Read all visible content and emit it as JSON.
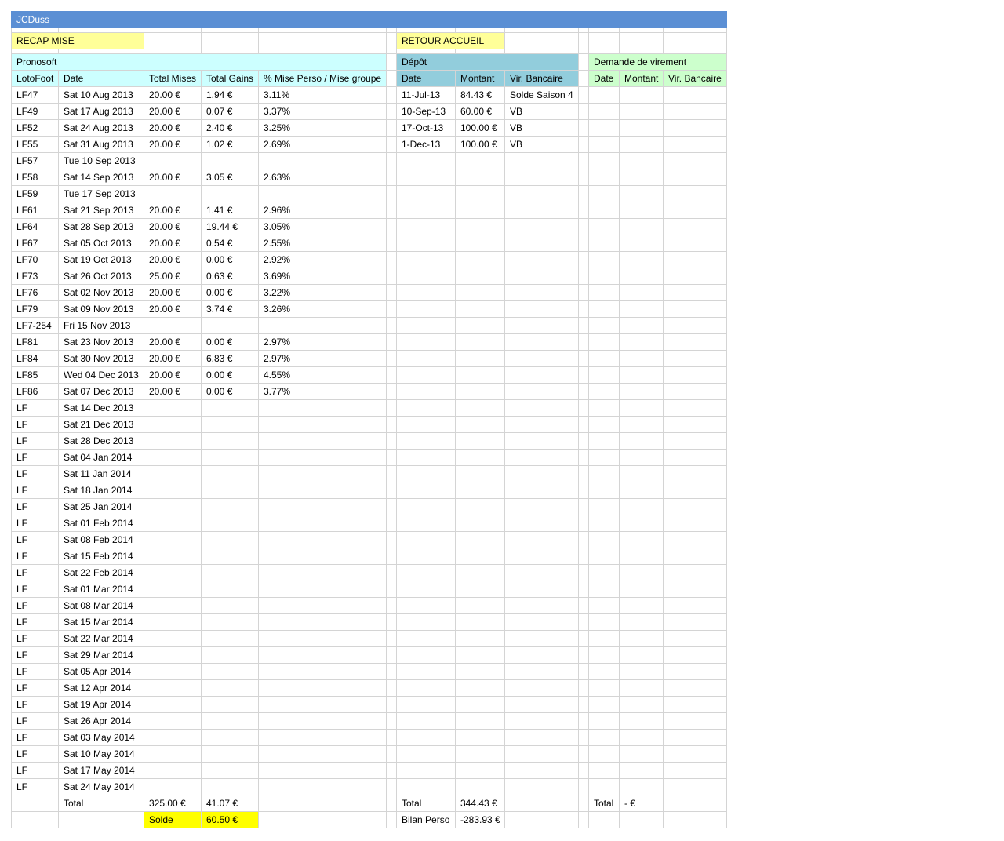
{
  "title": "JCDuss",
  "links": {
    "recap": "RECAP MISE",
    "retour": "RETOUR ACCUEIL"
  },
  "sections": {
    "pronosoft": "Pronosoft",
    "depot": "Dépôt",
    "demande": "Demande de virement"
  },
  "headers": {
    "pronosoft": [
      "LotoFoot",
      "Date",
      "Total Mises",
      "Total Gains",
      "% Mise Perso / Mise groupe"
    ],
    "depot": [
      "Date",
      "Montant",
      "Vir. Bancaire"
    ],
    "demande": [
      "Date",
      "Montant",
      "Vir. Bancaire"
    ]
  },
  "rows": [
    [
      "LF47",
      "Sat 10 Aug 2013",
      "20.00 €",
      "1.94 €",
      "3.11%"
    ],
    [
      "LF49",
      "Sat 17 Aug 2013",
      "20.00 €",
      "0.07 €",
      "3.37%"
    ],
    [
      "LF52",
      "Sat 24 Aug 2013",
      "20.00 €",
      "2.40 €",
      "3.25%"
    ],
    [
      "LF55",
      "Sat 31 Aug 2013",
      "20.00 €",
      "1.02 €",
      "2.69%"
    ],
    [
      "LF57",
      "Tue 10 Sep 2013",
      "",
      "",
      ""
    ],
    [
      "LF58",
      "Sat 14 Sep 2013",
      "20.00 €",
      "3.05 €",
      "2.63%"
    ],
    [
      "LF59",
      "Tue 17 Sep 2013",
      "",
      "",
      ""
    ],
    [
      "LF61",
      "Sat 21 Sep 2013",
      "20.00 €",
      "1.41 €",
      "2.96%"
    ],
    [
      "LF64",
      "Sat 28 Sep 2013",
      "20.00 €",
      "19.44 €",
      "3.05%"
    ],
    [
      "LF67",
      "Sat 05 Oct 2013",
      "20.00 €",
      "0.54 €",
      "2.55%"
    ],
    [
      "LF70",
      "Sat 19 Oct 2013",
      "20.00 €",
      "0.00 €",
      "2.92%"
    ],
    [
      "LF73",
      "Sat 26 Oct 2013",
      "25.00 €",
      "0.63 €",
      "3.69%"
    ],
    [
      "LF76",
      "Sat 02 Nov 2013",
      "20.00 €",
      "0.00 €",
      "3.22%"
    ],
    [
      "LF79",
      "Sat 09 Nov 2013",
      "20.00 €",
      "3.74 €",
      "3.26%"
    ],
    [
      "LF7-254",
      "Fri 15 Nov 2013",
      "",
      "",
      ""
    ],
    [
      "LF81",
      "Sat 23 Nov 2013",
      "20.00 €",
      "0.00 €",
      "2.97%"
    ],
    [
      "LF84",
      "Sat 30 Nov 2013",
      "20.00 €",
      "6.83 €",
      "2.97%"
    ],
    [
      "LF85",
      "Wed 04 Dec 2013",
      "20.00 €",
      "0.00 €",
      "4.55%"
    ],
    [
      "LF86",
      "Sat 07 Dec 2013",
      "20.00 €",
      "0.00 €",
      "3.77%"
    ],
    [
      "LF",
      "Sat 14 Dec 2013",
      "",
      "",
      ""
    ],
    [
      "LF",
      "Sat 21 Dec 2013",
      "",
      "",
      ""
    ],
    [
      "LF",
      "Sat 28 Dec 2013",
      "",
      "",
      ""
    ],
    [
      "LF",
      "Sat 04 Jan 2014",
      "",
      "",
      ""
    ],
    [
      "LF",
      "Sat 11 Jan 2014",
      "",
      "",
      ""
    ],
    [
      "LF",
      "Sat 18 Jan 2014",
      "",
      "",
      ""
    ],
    [
      "LF",
      "Sat 25 Jan 2014",
      "",
      "",
      ""
    ],
    [
      "LF",
      "Sat 01 Feb 2014",
      "",
      "",
      ""
    ],
    [
      "LF",
      "Sat 08 Feb 2014",
      "",
      "",
      ""
    ],
    [
      "LF",
      "Sat 15 Feb 2014",
      "",
      "",
      ""
    ],
    [
      "LF",
      "Sat 22 Feb 2014",
      "",
      "",
      ""
    ],
    [
      "LF",
      "Sat 01 Mar 2014",
      "",
      "",
      ""
    ],
    [
      "LF",
      "Sat 08 Mar 2014",
      "",
      "",
      ""
    ],
    [
      "LF",
      "Sat 15 Mar 2014",
      "",
      "",
      ""
    ],
    [
      "LF",
      "Sat 22 Mar 2014",
      "",
      "",
      ""
    ],
    [
      "LF",
      "Sat 29 Mar 2014",
      "",
      "",
      ""
    ],
    [
      "LF",
      "Sat 05 Apr 2014",
      "",
      "",
      ""
    ],
    [
      "LF",
      "Sat 12 Apr 2014",
      "",
      "",
      ""
    ],
    [
      "LF",
      "Sat 19 Apr 2014",
      "",
      "",
      ""
    ],
    [
      "LF",
      "Sat 26 Apr 2014",
      "",
      "",
      ""
    ],
    [
      "LF",
      "Sat 03 May 2014",
      "",
      "",
      ""
    ],
    [
      "LF",
      "Sat 10 May 2014",
      "",
      "",
      ""
    ],
    [
      "LF",
      "Sat 17 May 2014",
      "",
      "",
      ""
    ],
    [
      "LF",
      "Sat 24 May 2014",
      "",
      "",
      ""
    ]
  ],
  "depot_rows": [
    [
      "11-Jul-13",
      "84.43 €",
      "Solde Saison 4"
    ],
    [
      "10-Sep-13",
      "60.00 €",
      "VB"
    ],
    [
      "17-Oct-13",
      "100.00 €",
      "VB"
    ],
    [
      "1-Dec-13",
      "100.00 €",
      "VB"
    ]
  ],
  "demande_rows": [],
  "totals": {
    "label": "Total",
    "mises": "325.00 €",
    "gains": "41.07 €",
    "solde_label": "Solde",
    "solde": "60.50 €",
    "depot_label": "Total",
    "depot_total": "344.43 €",
    "bilan_label": "Bilan Perso",
    "bilan": "-283.93 €",
    "demande_label": "Total",
    "demande_total": "- €"
  }
}
